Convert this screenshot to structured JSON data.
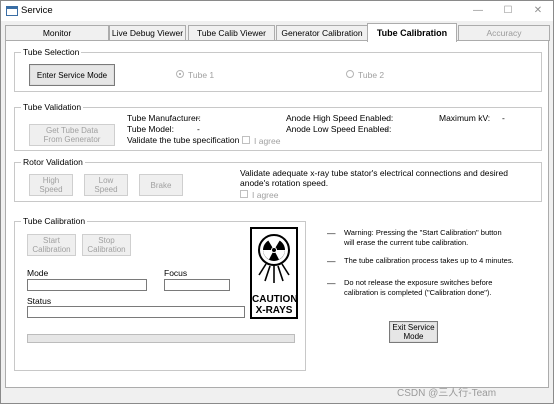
{
  "window": {
    "title": "Service",
    "controls": {
      "minimize": "—",
      "maximize": "☐",
      "close": "✕"
    }
  },
  "tabs": [
    {
      "label": "Monitor",
      "state": "normal"
    },
    {
      "label": "Live Debug Viewer",
      "state": "normal"
    },
    {
      "label": "Tube Calib Viewer",
      "state": "normal"
    },
    {
      "label": "Generator Calibration",
      "state": "normal"
    },
    {
      "label": "Tube Calibration",
      "state": "active"
    },
    {
      "label": "Accuracy",
      "state": "disabled"
    }
  ],
  "tube_selection": {
    "legend": "Tube Selection",
    "enter_service_mode": "Enter Service Mode",
    "tube1": "Tube 1",
    "tube2": "Tube 2",
    "selected": "Tube 1"
  },
  "tube_validation": {
    "legend": "Tube Validation",
    "get_tube_data": "Get Tube Data\nFrom Generator",
    "manufacturer_label": "Tube Manufacturer:",
    "manufacturer_value": "-",
    "model_label": "Tube Model:",
    "model_value": "-",
    "validate_label": "Validate the tube specification :",
    "agree": "I agree",
    "anode_high_label": "Anode High Speed Enabled:",
    "anode_high_value": "-",
    "anode_low_label": "Anode Low Speed Enabled:",
    "anode_low_value": "-",
    "max_kv_label": "Maximum kV:",
    "max_kv_value": "-"
  },
  "rotor_validation": {
    "legend": "Rotor Validation",
    "high_speed": "High Speed",
    "low_speed": "Low Speed",
    "brake": "Brake",
    "instruction": "Validate adequate x-ray tube stator's electrical connections and desired anode's rotation speed.",
    "agree": "I agree"
  },
  "tube_calibration": {
    "legend": "Tube Calibration",
    "start": "Start\nCalibration",
    "stop": "Stop\nCalibration",
    "mode_label": "Mode",
    "mode_value": "",
    "focus_label": "Focus",
    "focus_value": "",
    "status_label": "Status",
    "status_value": "",
    "progress": 0,
    "caution_line1": "CAUTION",
    "caution_line2": "X-RAYS"
  },
  "notes": {
    "bullet": "—",
    "warning": "Warning: Pressing the \"Start Calibration\" button\nwill erase the current tube calibration.",
    "duration": "The tube calibration process takes up to 4 minutes.",
    "release": "Do not release the exposure switches before\ncalibration is completed (\"Calibration done\")."
  },
  "exit_service_mode": "Exit Service\nMode",
  "watermark": "CSDN @三人行-Team",
  "colors": {
    "progress": "#06b025",
    "disabled_text": "#a0a0a0",
    "active_tab": "#ffffff"
  }
}
